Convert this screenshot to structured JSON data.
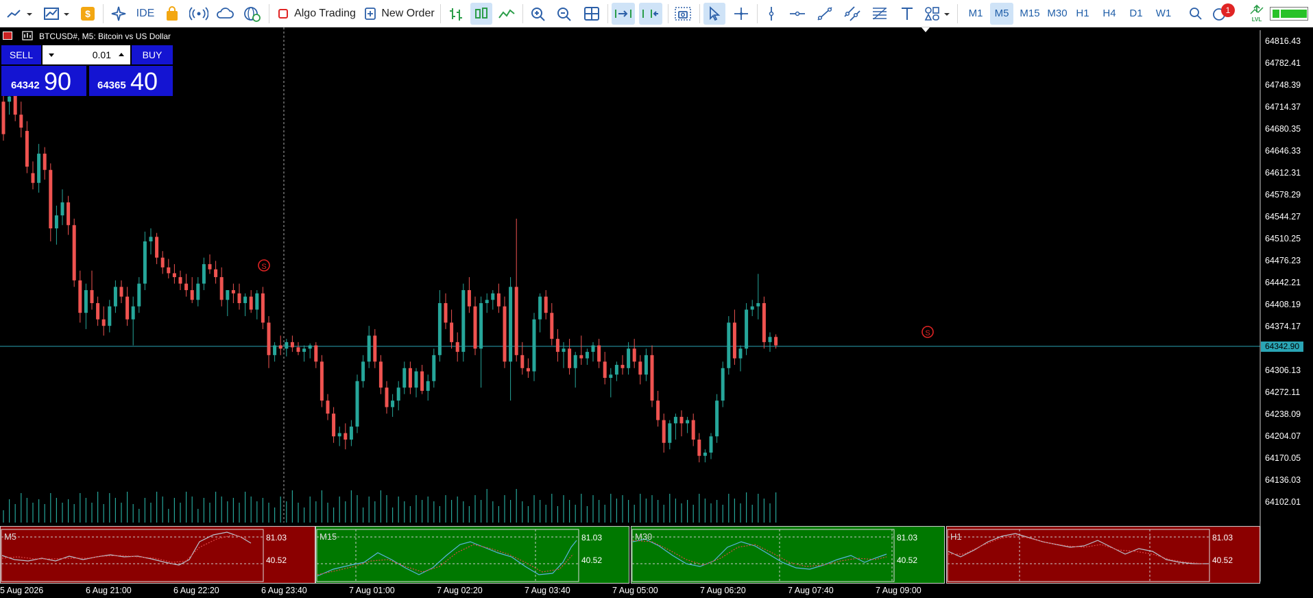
{
  "toolbar": {
    "algo_trading_label": "Algo Trading",
    "new_order_label": "New Order",
    "ide_label": "IDE",
    "notification_count": "1",
    "timeframes": [
      "M1",
      "M5",
      "M15",
      "M30",
      "H1",
      "H4",
      "D1",
      "W1"
    ],
    "active_timeframe": "M5"
  },
  "chart": {
    "title": "BTCUSD#, M5:  Bitcoin vs US Dollar",
    "sell_label": "SELL",
    "buy_label": "BUY",
    "lot": "0.01",
    "sell_price_main": "64342",
    "sell_price_big": "90",
    "buy_price_main": "64365",
    "buy_price_big": "40",
    "current_price": "64342.90",
    "price_axis": [
      "64816.43",
      "64782.41",
      "64748.39",
      "64714.37",
      "64680.35",
      "64646.33",
      "64612.31",
      "64578.29",
      "64544.27",
      "64510.25",
      "64476.23",
      "64442.21",
      "64408.19",
      "64374.17",
      "64306.13",
      "64272.11",
      "64238.09",
      "64204.07",
      "64170.05",
      "64136.03",
      "64102.01"
    ],
    "time_axis": [
      "5 Aug 2026",
      "6 Aug 21:00",
      "6 Aug 22:20",
      "6 Aug 23:40",
      "7 Aug 01:00",
      "7 Aug 02:20",
      "7 Aug 03:40",
      "7 Aug 05:00",
      "7 Aug 06:20",
      "7 Aug 07:40",
      "7 Aug 09:00"
    ],
    "colors": {
      "bull": "#26a69a",
      "bear": "#ef5350",
      "price_line": "#2aa5b5",
      "panel_red": "#8b0000",
      "panel_green": "#007800",
      "panel_blue": "#1414d2"
    }
  },
  "mini_panels": [
    {
      "tf": "M5",
      "upper": "81.03",
      "lower": "40.52",
      "state": "red"
    },
    {
      "tf": "M15",
      "upper": "81.03",
      "lower": "40.52",
      "state": "green"
    },
    {
      "tf": "M30",
      "upper": "81.03",
      "lower": "40.52",
      "state": "green"
    },
    {
      "tf": "H1",
      "upper": "81.03",
      "lower": "40.52",
      "state": "red"
    }
  ],
  "chart_data": {
    "type": "candlestick",
    "ylim": [
      64085,
      64830
    ],
    "candles": [
      [
        64720,
        64735,
        64660,
        64670
      ],
      [
        64720,
        64740,
        64700,
        64728
      ],
      [
        64730,
        64745,
        64690,
        64700
      ],
      [
        64700,
        64720,
        64665,
        64680
      ],
      [
        64675,
        64690,
        64610,
        64620
      ],
      [
        64610,
        64628,
        64585,
        64595
      ],
      [
        64595,
        64655,
        64580,
        64640
      ],
      [
        64640,
        64650,
        64600,
        64615
      ],
      [
        64615,
        64625,
        64505,
        64525
      ],
      [
        64525,
        64560,
        64500,
        64545
      ],
      [
        64545,
        64585,
        64530,
        64565
      ],
      [
        64565,
        64575,
        64515,
        64530
      ],
      [
        64530,
        64540,
        64435,
        64445
      ],
      [
        64445,
        64460,
        64380,
        64395
      ],
      [
        64395,
        64440,
        64370,
        64430
      ],
      [
        64430,
        64460,
        64400,
        64410
      ],
      [
        64410,
        64420,
        64375,
        64385
      ],
      [
        64385,
        64405,
        64360,
        64375
      ],
      [
        64375,
        64415,
        64365,
        64405
      ],
      [
        64405,
        64445,
        64395,
        64435
      ],
      [
        64435,
        64445,
        64410,
        64420
      ],
      [
        64420,
        64435,
        64375,
        64385
      ],
      [
        64385,
        64420,
        64345,
        64405
      ],
      [
        64405,
        64450,
        64395,
        64440
      ],
      [
        64440,
        64520,
        64430,
        64505
      ],
      [
        64505,
        64525,
        64485,
        64512
      ],
      [
        64512,
        64518,
        64470,
        64480
      ],
      [
        64480,
        64490,
        64455,
        64465
      ],
      [
        64465,
        64478,
        64448,
        64456
      ],
      [
        64456,
        64470,
        64440,
        64450
      ],
      [
        64450,
        64460,
        64430,
        64440
      ],
      [
        64440,
        64455,
        64420,
        64430
      ],
      [
        64430,
        64450,
        64410,
        64415
      ],
      [
        64415,
        64450,
        64405,
        64440
      ],
      [
        64440,
        64480,
        64430,
        64470
      ],
      [
        64470,
        64485,
        64455,
        64462
      ],
      [
        64462,
        64475,
        64440,
        64450
      ],
      [
        64450,
        64465,
        64405,
        64415
      ],
      [
        64415,
        64430,
        64390,
        64430
      ],
      [
        64430,
        64440,
        64410,
        64425
      ],
      [
        64425,
        64440,
        64400,
        64410
      ],
      [
        64410,
        64425,
        64390,
        64420
      ],
      [
        64420,
        64430,
        64395,
        64400
      ],
      [
        64400,
        64430,
        64385,
        64425
      ],
      [
        64425,
        64435,
        64370,
        64380
      ],
      [
        64380,
        64390,
        64310,
        64330
      ],
      [
        64330,
        64350,
        64320,
        64345
      ],
      [
        64345,
        64360,
        64330,
        64340
      ],
      [
        64340,
        64355,
        64328,
        64350
      ],
      [
        64350,
        64360,
        64335,
        64342
      ],
      [
        64342,
        64350,
        64330,
        64335
      ],
      [
        64335,
        64345,
        64320,
        64340
      ],
      [
        64340,
        64348,
        64325,
        64345
      ],
      [
        64345,
        64350,
        64310,
        64320
      ],
      [
        64320,
        64330,
        64250,
        64260
      ],
      [
        64260,
        64270,
        64230,
        64240
      ],
      [
        64240,
        64250,
        64195,
        64205
      ],
      [
        64205,
        64220,
        64190,
        64210
      ],
      [
        64210,
        64225,
        64185,
        64200
      ],
      [
        64200,
        64230,
        64190,
        64220
      ],
      [
        64220,
        64300,
        64210,
        64290
      ],
      [
        64290,
        64330,
        64280,
        64320
      ],
      [
        64320,
        64375,
        64310,
        64360
      ],
      [
        64360,
        64370,
        64310,
        64320
      ],
      [
        64320,
        64330,
        64270,
        64280
      ],
      [
        64280,
        64290,
        64240,
        64250
      ],
      [
        64250,
        64270,
        64235,
        64260
      ],
      [
        64260,
        64290,
        64245,
        64280
      ],
      [
        64280,
        64320,
        64270,
        64310
      ],
      [
        64310,
        64320,
        64270,
        64280
      ],
      [
        64280,
        64310,
        64265,
        64305
      ],
      [
        64305,
        64315,
        64270,
        64275
      ],
      [
        64275,
        64300,
        64260,
        64290
      ],
      [
        64290,
        64340,
        64280,
        64330
      ],
      [
        64330,
        64430,
        64320,
        64410
      ],
      [
        64410,
        64425,
        64370,
        64380
      ],
      [
        64380,
        64400,
        64340,
        64350
      ],
      [
        64350,
        64365,
        64320,
        64335
      ],
      [
        64335,
        64440,
        64320,
        64430
      ],
      [
        64430,
        64450,
        64395,
        64405
      ],
      [
        64405,
        64420,
        64330,
        64340
      ],
      [
        64340,
        64420,
        64280,
        64410
      ],
      [
        64410,
        64425,
        64395,
        64415
      ],
      [
        64415,
        64430,
        64400,
        64425
      ],
      [
        64425,
        64440,
        64395,
        64405
      ],
      [
        64405,
        64420,
        64310,
        64320
      ],
      [
        64320,
        64450,
        64260,
        64435
      ],
      [
        64435,
        64540,
        64320,
        64330
      ],
      [
        64330,
        64350,
        64300,
        64310
      ],
      [
        64310,
        64325,
        64295,
        64305
      ],
      [
        64305,
        64395,
        64290,
        64385
      ],
      [
        64385,
        64425,
        64365,
        64420
      ],
      [
        64420,
        64430,
        64385,
        64395
      ],
      [
        64395,
        64410,
        64345,
        64355
      ],
      [
        64355,
        64370,
        64320,
        64335
      ],
      [
        64335,
        64350,
        64310,
        64340
      ],
      [
        64340,
        64355,
        64300,
        64310
      ],
      [
        64310,
        64335,
        64280,
        64330
      ],
      [
        64330,
        64360,
        64315,
        64325
      ],
      [
        64325,
        64340,
        64315,
        64335
      ],
      [
        64335,
        64350,
        64320,
        64345
      ],
      [
        64345,
        64355,
        64310,
        64320
      ],
      [
        64320,
        64335,
        64285,
        64295
      ],
      [
        64295,
        64310,
        64265,
        64300
      ],
      [
        64300,
        64320,
        64290,
        64315
      ],
      [
        64315,
        64330,
        64300,
        64310
      ],
      [
        64310,
        64350,
        64300,
        64340
      ],
      [
        64340,
        64355,
        64310,
        64320
      ],
      [
        64320,
        64330,
        64285,
        64300
      ],
      [
        64300,
        64340,
        64290,
        64330
      ],
      [
        64330,
        64345,
        64250,
        64260
      ],
      [
        64260,
        64275,
        64220,
        64230
      ],
      [
        64230,
        64240,
        64180,
        64195
      ],
      [
        64195,
        64230,
        64185,
        64225
      ],
      [
        64225,
        64240,
        64200,
        64235
      ],
      [
        64235,
        64245,
        64205,
        64225
      ],
      [
        64225,
        64235,
        64210,
        64230
      ],
      [
        64230,
        64240,
        64190,
        64200
      ],
      [
        64200,
        64210,
        64165,
        64175
      ],
      [
        64175,
        64185,
        64165,
        64180
      ],
      [
        64180,
        64210,
        64170,
        64205
      ],
      [
        64205,
        64270,
        64195,
        64260
      ],
      [
        64260,
        64320,
        64250,
        64310
      ],
      [
        64310,
        64390,
        64300,
        64380
      ],
      [
        64380,
        64400,
        64315,
        64325
      ],
      [
        64325,
        64345,
        64305,
        64340
      ],
      [
        64340,
        64410,
        64330,
        64400
      ],
      [
        64400,
        64415,
        64390,
        64405
      ],
      [
        64405,
        64455,
        64385,
        64410
      ],
      [
        64410,
        64420,
        64340,
        64350
      ],
      [
        64350,
        64365,
        64335,
        64358
      ],
      [
        64358,
        64362,
        64340,
        64345
      ]
    ]
  }
}
